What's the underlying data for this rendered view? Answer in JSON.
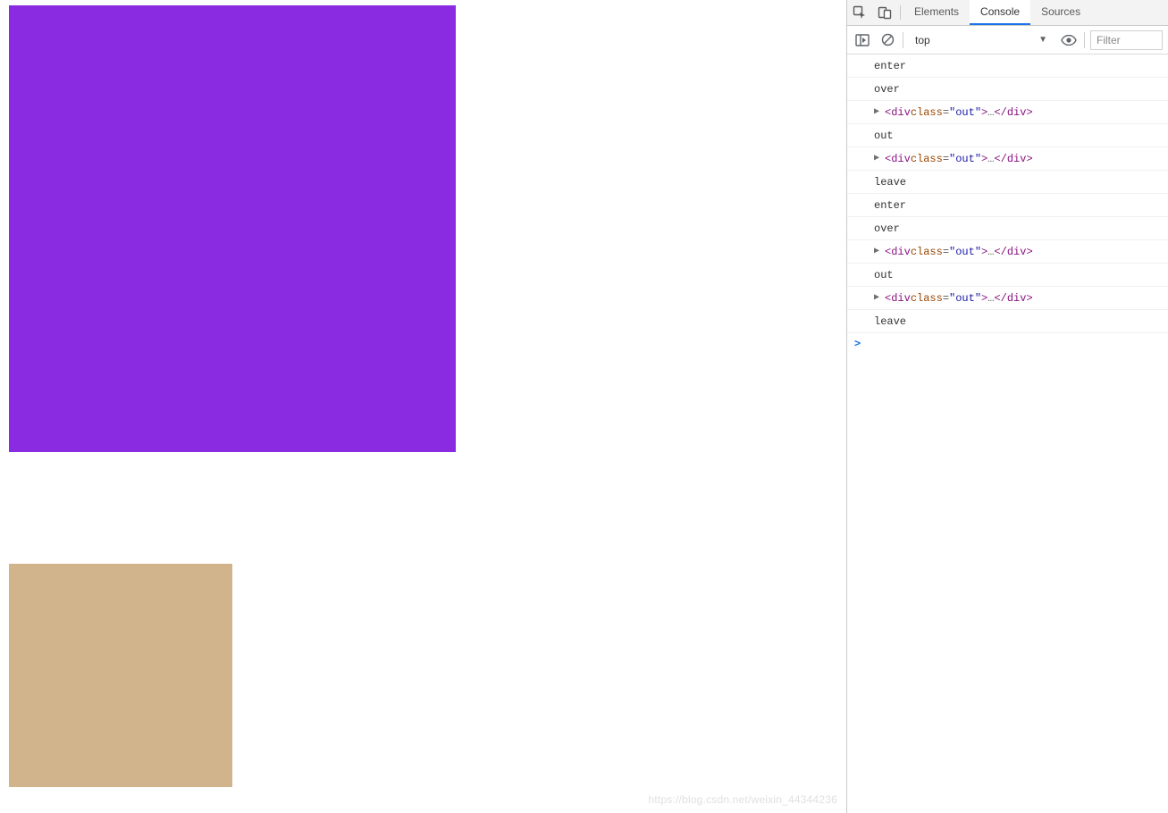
{
  "page": {
    "colors": {
      "purple": "#8a2be2",
      "tan": "#d2b48c"
    },
    "watermark": "https://blog.csdn.net/weixin_44344236"
  },
  "devtools": {
    "tabs": {
      "elements": "Elements",
      "console": "Console",
      "sources": "Sources",
      "active": "Console"
    },
    "context": {
      "selected": "top"
    },
    "filter": {
      "placeholder": "Filter"
    },
    "elementSnippet": {
      "openAngle": "<",
      "tag": "div",
      "attrName": "class",
      "eq": "=",
      "q1": "\"",
      "attrValue": "out",
      "q2": "\"",
      "closeAngle": ">",
      "ellipsis": "…",
      "endOpen": "</",
      "endClose": ">"
    },
    "logs": [
      {
        "type": "text",
        "text": "enter"
      },
      {
        "type": "text",
        "text": "over"
      },
      {
        "type": "element"
      },
      {
        "type": "text",
        "text": "out"
      },
      {
        "type": "element"
      },
      {
        "type": "text",
        "text": "leave"
      },
      {
        "type": "text",
        "text": "enter"
      },
      {
        "type": "text",
        "text": "over"
      },
      {
        "type": "element"
      },
      {
        "type": "text",
        "text": "out"
      },
      {
        "type": "element"
      },
      {
        "type": "text",
        "text": "leave"
      }
    ],
    "prompt": ">"
  }
}
